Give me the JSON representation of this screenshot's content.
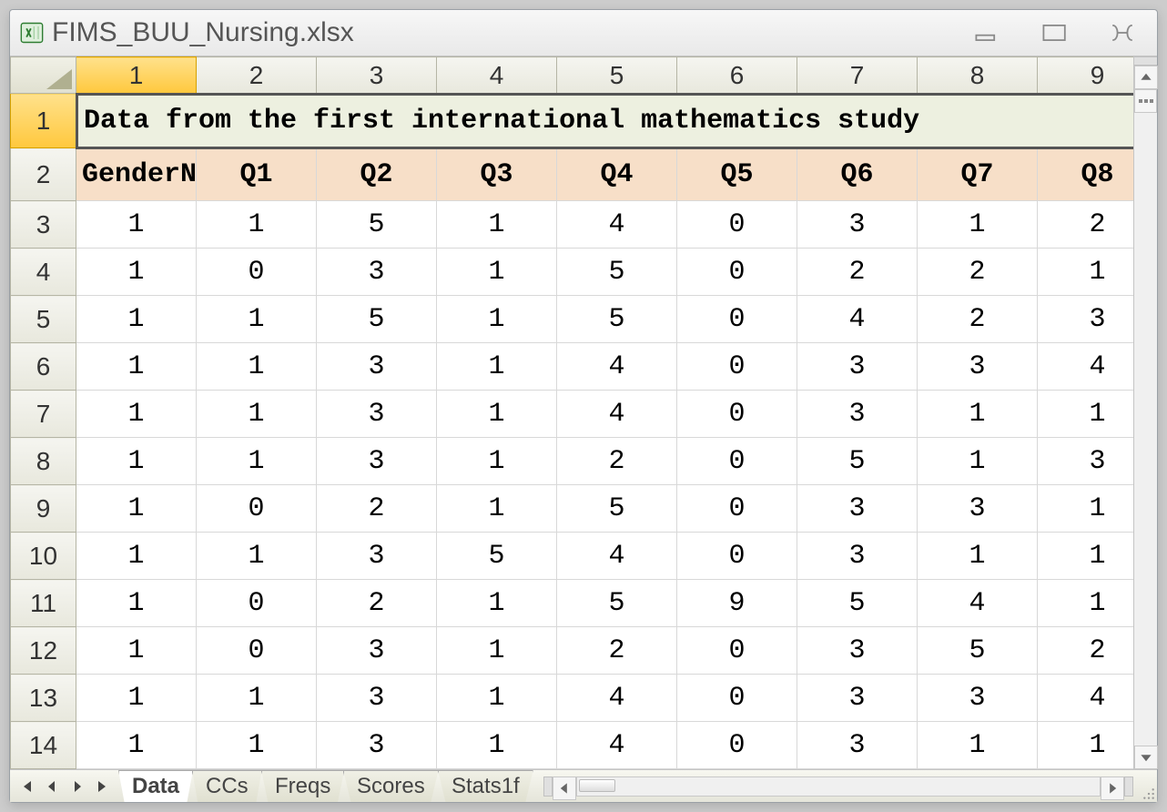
{
  "window": {
    "title": "FIMS_BUU_Nursing.xlsx"
  },
  "columns": [
    "1",
    "2",
    "3",
    "4",
    "5",
    "6",
    "7",
    "8",
    "9"
  ],
  "rows": [
    "1",
    "2",
    "3",
    "4",
    "5",
    "6",
    "7",
    "8",
    "9",
    "10",
    "11",
    "12",
    "13",
    "14"
  ],
  "selected_cell": {
    "row": 0,
    "col": 0
  },
  "title_text": "Data from the first international mathematics study",
  "headers": [
    "GenderN",
    "Q1",
    "Q2",
    "Q3",
    "Q4",
    "Q5",
    "Q6",
    "Q7",
    "Q8"
  ],
  "data": [
    [
      "1",
      "1",
      "5",
      "1",
      "4",
      "0",
      "3",
      "1",
      "2"
    ],
    [
      "1",
      "0",
      "3",
      "1",
      "5",
      "0",
      "2",
      "2",
      "1"
    ],
    [
      "1",
      "1",
      "5",
      "1",
      "5",
      "0",
      "4",
      "2",
      "3"
    ],
    [
      "1",
      "1",
      "3",
      "1",
      "4",
      "0",
      "3",
      "3",
      "4"
    ],
    [
      "1",
      "1",
      "3",
      "1",
      "4",
      "0",
      "3",
      "1",
      "1"
    ],
    [
      "1",
      "1",
      "3",
      "1",
      "2",
      "0",
      "5",
      "1",
      "3"
    ],
    [
      "1",
      "0",
      "2",
      "1",
      "5",
      "0",
      "3",
      "3",
      "1"
    ],
    [
      "1",
      "1",
      "3",
      "5",
      "4",
      "0",
      "3",
      "1",
      "1"
    ],
    [
      "1",
      "0",
      "2",
      "1",
      "5",
      "9",
      "5",
      "4",
      "1"
    ],
    [
      "1",
      "0",
      "3",
      "1",
      "2",
      "0",
      "3",
      "5",
      "2"
    ],
    [
      "1",
      "1",
      "3",
      "1",
      "4",
      "0",
      "3",
      "3",
      "4"
    ],
    [
      "1",
      "1",
      "3",
      "1",
      "4",
      "0",
      "3",
      "1",
      "1"
    ]
  ],
  "tabs": [
    {
      "label": "Data",
      "active": true
    },
    {
      "label": "CCs",
      "active": false
    },
    {
      "label": "Freqs",
      "active": false
    },
    {
      "label": "Scores",
      "active": false
    },
    {
      "label": "Stats1f",
      "active": false
    }
  ]
}
